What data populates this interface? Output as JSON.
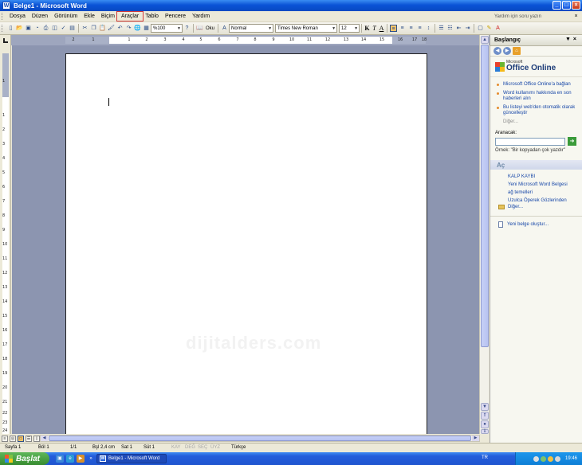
{
  "window": {
    "title": "Belge1 - Microsoft Word",
    "icon_letter": "W"
  },
  "menu": {
    "items": [
      "Dosya",
      "Düzen",
      "Görünüm",
      "Ekle",
      "Biçim",
      "Araçlar",
      "Tablo",
      "Pencere",
      "Yardım"
    ],
    "highlighted": "Araçlar",
    "help_placeholder": "Yardım için soru yazın",
    "close_glyph": "×"
  },
  "toolbar": {
    "zoom": "%100",
    "read_label": "Oku",
    "style": "Normal",
    "font": "Times New Roman",
    "size": "12",
    "bold": "K",
    "italic": "T",
    "underline": "A"
  },
  "ruler": {
    "h_numbers": [
      "2",
      "1",
      "1",
      "2",
      "3",
      "4",
      "5",
      "6",
      "7",
      "8",
      "9",
      "10",
      "11",
      "12",
      "13",
      "14",
      "15",
      "16",
      "17",
      "18"
    ],
    "v_numbers": [
      "1",
      "1",
      "2",
      "3",
      "4",
      "5",
      "6",
      "7",
      "8",
      "9",
      "10",
      "11",
      "12",
      "13",
      "14",
      "15",
      "16",
      "17",
      "18",
      "19",
      "20",
      "21",
      "22",
      "23",
      "24"
    ]
  },
  "document": {
    "watermark": "dijitalders.com"
  },
  "taskpane": {
    "title": "Başlangıç",
    "office_small": "Microsoft",
    "office_big": "Office Online",
    "links": [
      "Microsoft Office Online'a bağlan",
      "Word kullanımı hakkında en son haberleri alın",
      "Bu listeyi web'den otomatik olarak güncelleştir"
    ],
    "more": "Diğer...",
    "search_label": "Aranacak:",
    "search_value": "",
    "example": "Örnek: \"Bir kopyadan çok yazdır\"",
    "open_heading": "Aç",
    "open_files": [
      "KALP KAYBI",
      "Yeni Microsoft Word Belgesi",
      "ağ temelleri",
      "Uzulca Öperek Gözlerinden"
    ],
    "open_more": "Diğer...",
    "new_doc": "Yeni belge oluştur..."
  },
  "status": {
    "page": "Sayfa 1",
    "section": "Böl 1",
    "page_of": "1/1",
    "position": "Bşl 2,4 cm",
    "line": "Sat 1",
    "column": "Süt 1",
    "rec": "KAY",
    "trk": "DEĞ",
    "ext": "SEÇ",
    "ovr": "ÜYZ",
    "language": "Türkçe"
  },
  "taskbar": {
    "start": "Başlat",
    "task": "Belge1 - Microsoft Word",
    "lang": "TR",
    "clock": "19:46"
  },
  "colors": {
    "title_bar": "#0a53d6",
    "doc_background": "#8c95b0",
    "link_blue": "#1747a8",
    "highlight_border": "#d23a3a"
  }
}
